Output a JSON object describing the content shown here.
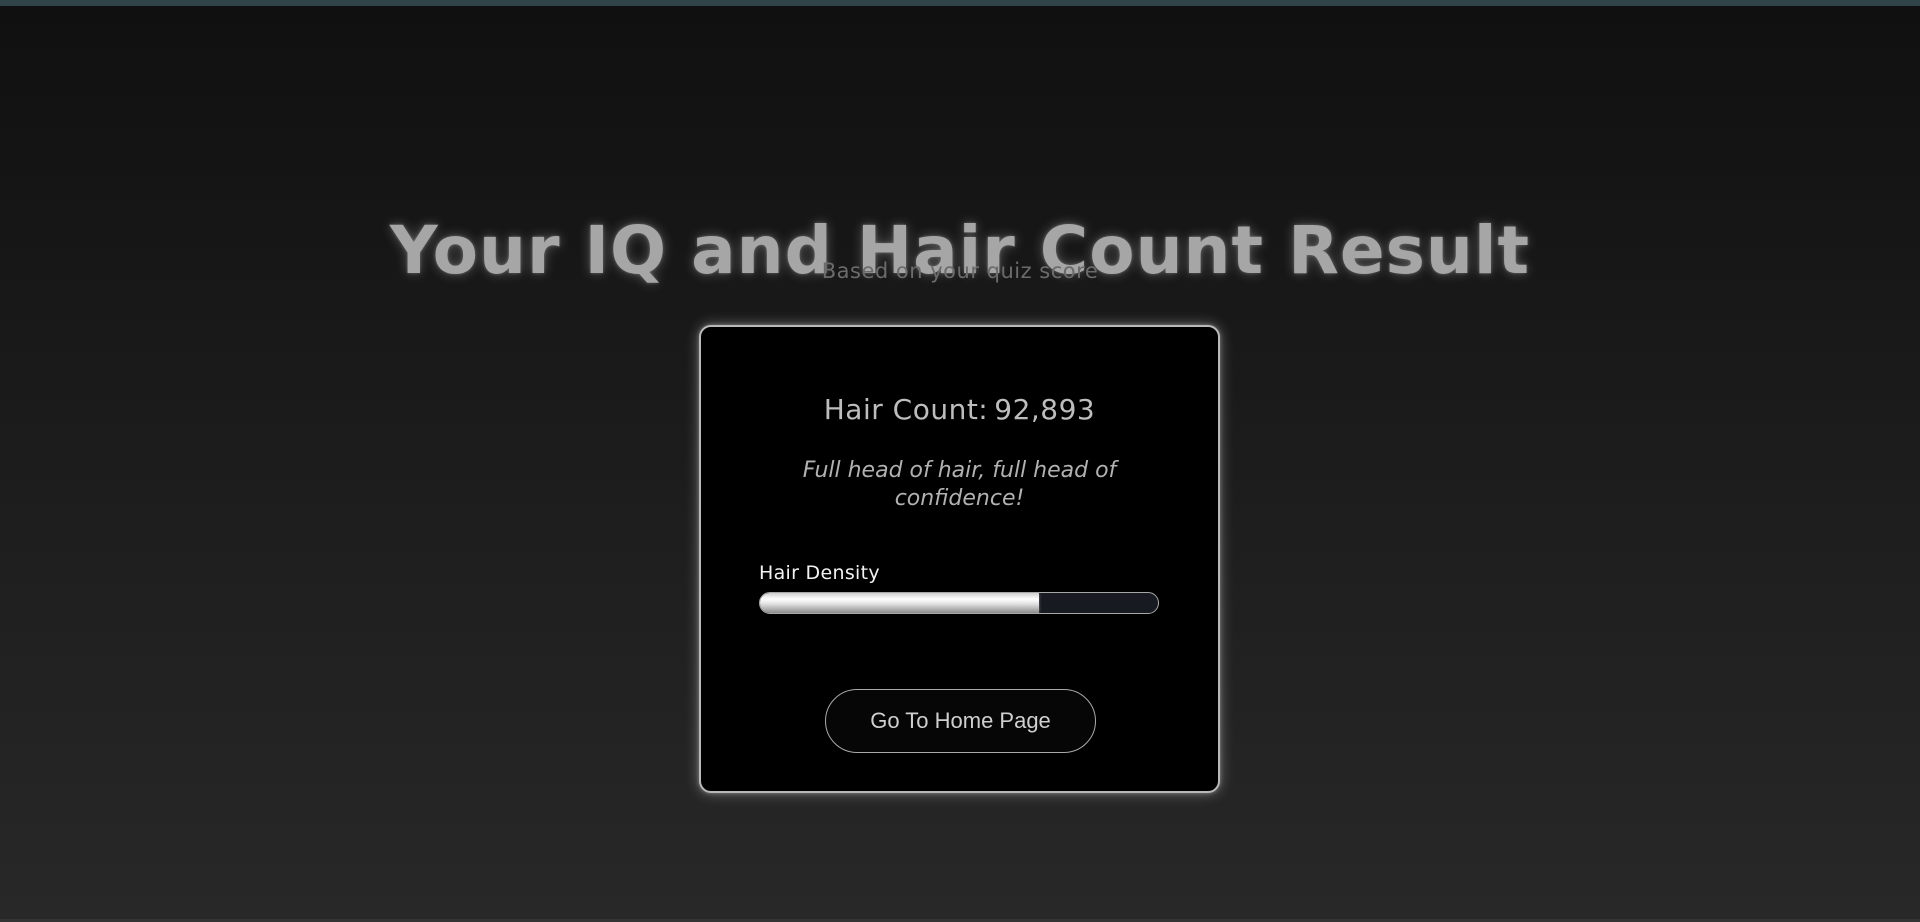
{
  "header": {
    "title": "Your IQ and Hair Count Result",
    "subtitle": "Based on your quiz score"
  },
  "result": {
    "hair_count_label": "Hair Count:",
    "hair_count_value": "92,893",
    "message": "Full head of hair, full head of confidence!",
    "density_label": "Hair Density",
    "density_fraction": 0.7
  },
  "actions": {
    "home_label": "Go To Home Page"
  },
  "colors": {
    "background_top": "#101010",
    "background_bottom": "#282828",
    "card_background": "#000000",
    "card_border": "#b9b9b9",
    "top_strip": "#2f4348"
  }
}
